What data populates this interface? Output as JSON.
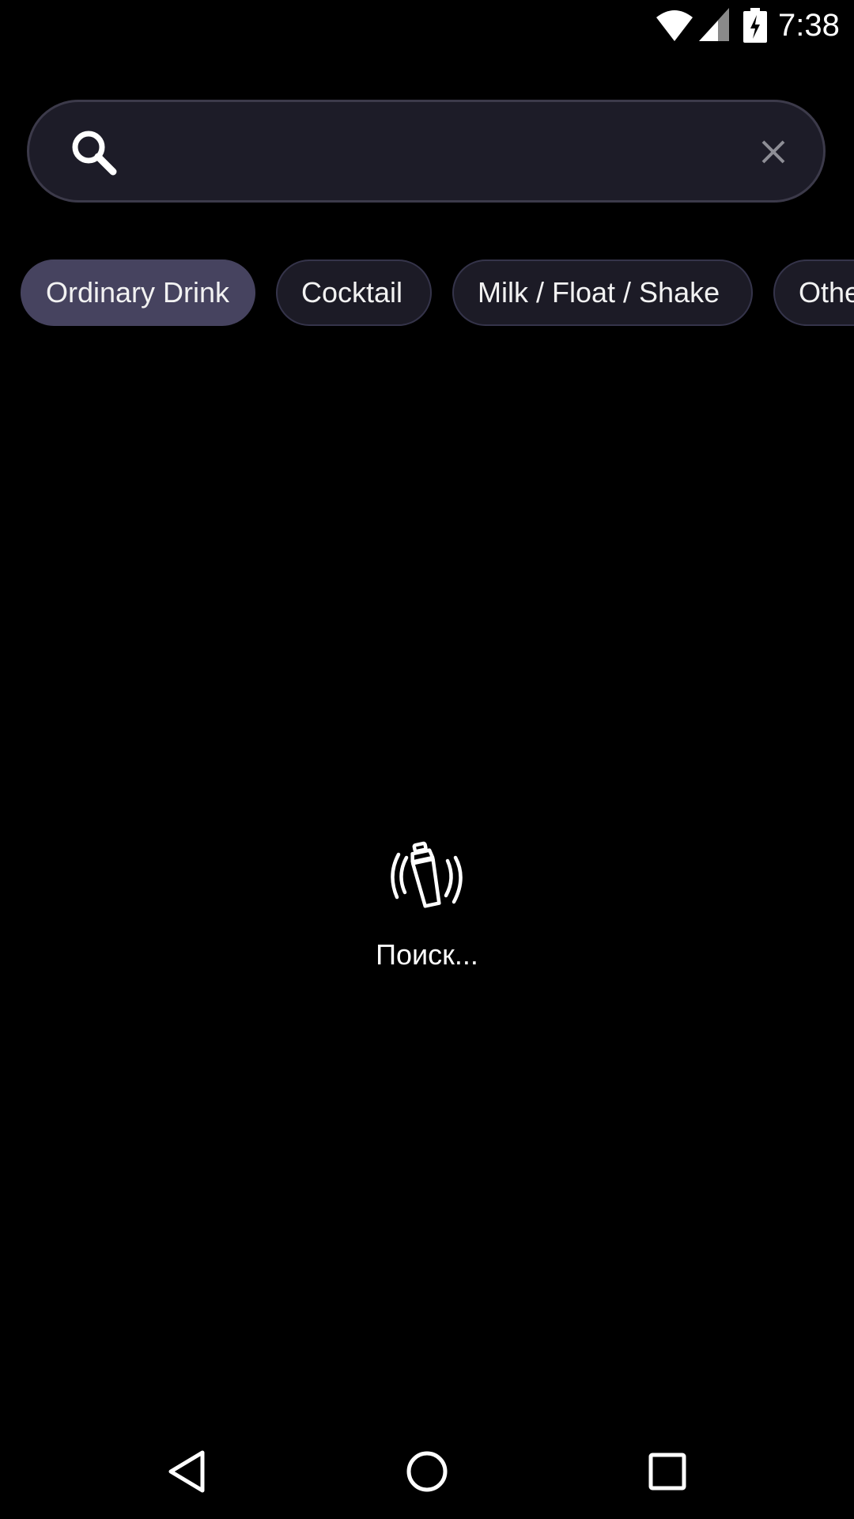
{
  "status_bar": {
    "time": "7:38",
    "icons": [
      "wifi-icon",
      "signal-icon",
      "battery-charging-icon"
    ]
  },
  "search": {
    "value": "",
    "placeholder": "",
    "leading_icon": "search-icon",
    "trailing_icon": "close-icon"
  },
  "categories": [
    {
      "label": "Ordinary Drink",
      "selected": true
    },
    {
      "label": "Cocktail",
      "selected": false
    },
    {
      "label": "Milk / Float / Shake",
      "selected": false
    },
    {
      "label": "Other / Unknown",
      "selected": false
    }
  ],
  "loading": {
    "icon": "cocktail-shaker-icon",
    "text": "Поиск..."
  },
  "nav_bar": {
    "icons": [
      "back-icon",
      "home-icon",
      "recents-icon"
    ]
  },
  "colors": {
    "background": "#000000",
    "search_background": "#1d1c28",
    "chip_background": "#1c1b26",
    "chip_selected_background": "#46435f",
    "text": "#ffffff"
  }
}
